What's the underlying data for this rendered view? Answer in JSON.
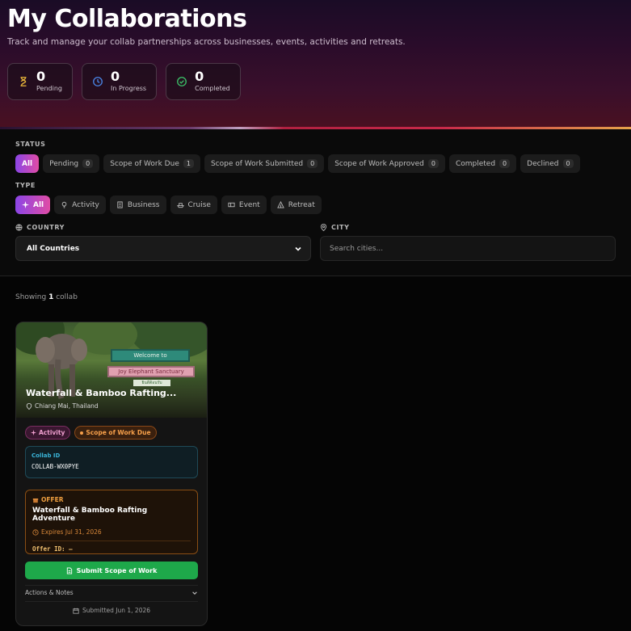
{
  "header": {
    "title": "My Collaborations",
    "subtitle": "Track and manage your collab partnerships across businesses, events, activities and retreats."
  },
  "stats": [
    {
      "value": "0",
      "label": "Pending",
      "icon": "hourglass-icon",
      "color": "#e7b43a"
    },
    {
      "value": "0",
      "label": "In Progress",
      "icon": "clock-icon",
      "color": "#4a86e8"
    },
    {
      "value": "0",
      "label": "Completed",
      "icon": "check-circle-icon",
      "color": "#3cc46a"
    }
  ],
  "filters": {
    "status_label": "STATUS",
    "status": [
      {
        "label": "All",
        "count": null,
        "active": true
      },
      {
        "label": "Pending",
        "count": "0"
      },
      {
        "label": "Scope of Work Due",
        "count": "1"
      },
      {
        "label": "Scope of Work Submitted",
        "count": "0"
      },
      {
        "label": "Scope of Work Approved",
        "count": "0"
      },
      {
        "label": "Completed",
        "count": "0"
      },
      {
        "label": "Declined",
        "count": "0"
      }
    ],
    "type_label": "TYPE",
    "types": [
      {
        "label": "All",
        "active": true
      },
      {
        "label": "Activity"
      },
      {
        "label": "Business"
      },
      {
        "label": "Cruise"
      },
      {
        "label": "Event"
      },
      {
        "label": "Retreat"
      }
    ],
    "country_label": "COUNTRY",
    "country_value": "All Countries",
    "city_label": "CITY",
    "city_placeholder": "Search cities..."
  },
  "results": {
    "prefix": "Showing",
    "count": "1",
    "suffix": "collab"
  },
  "card": {
    "title": "Waterfall & Bamboo Rafting...",
    "location": "Chiang Mai, Thailand",
    "image_sign_1": "Welcome to",
    "image_sign_2": "Joy Elephant Sanctuary",
    "image_sign_3": "ยินดีต้อนรับ",
    "badge_type": "Activity",
    "badge_status": "Scope of Work Due",
    "collab_id_label": "Collab ID",
    "collab_id": "COLLAB-WX0PYE",
    "offer_tag": "OFFER",
    "offer_title": "Waterfall & Bamboo Rafting Adventure",
    "offer_expires": "Expires Jul 31, 2026",
    "offer_id": "Offer ID: —",
    "submit_label": "Submit Scope of Work",
    "actions_label": "Actions & Notes",
    "submitted": "Submitted Jun 1, 2026"
  }
}
